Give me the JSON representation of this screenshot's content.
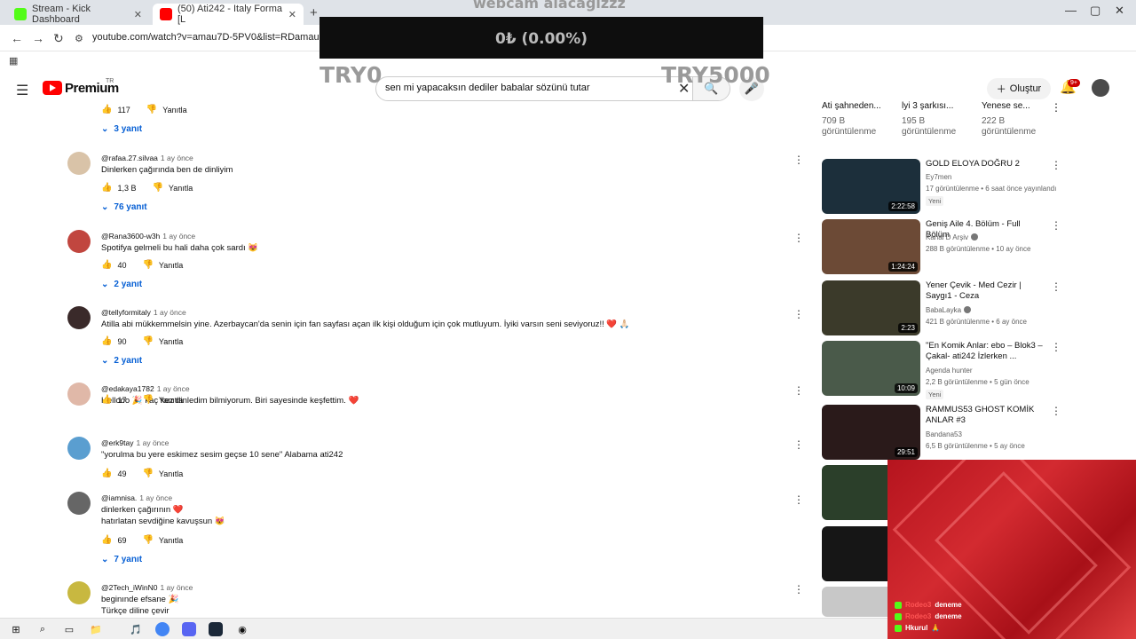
{
  "browser": {
    "tabs": [
      {
        "label": "Stream - Kick Dashboard",
        "active": false
      },
      {
        "label": "(50) Ati242 - Italy Forma [L",
        "active": true
      }
    ],
    "url": "youtube.com/watch?v=amau7D-5PV0&list=RDamau7D..."
  },
  "youtube": {
    "premium_label": "Premium",
    "country": "TR",
    "search_value": "sen mi yapacaksın dediler babalar sözünü tutar",
    "create_label": "Oluştur",
    "notif_count": "9+"
  },
  "overlay": {
    "title": "webcam alacağızzz",
    "value": "0₺ (0.00%)",
    "min": "TRY0",
    "max": "TRY5000"
  },
  "top_actions": {
    "likes": "117",
    "reply": "Yanıtla",
    "replies": "3 yanıt"
  },
  "comments": [
    {
      "user": "@rafaa.27.silvaa",
      "time": "1 ay önce",
      "text": "Dinlerken çağırında ben de dinliyim",
      "text2": "",
      "likes": "1,3 B",
      "reply": "Yanıtla",
      "replies": "76 yanıt"
    },
    {
      "user": "@Rana3600-w3h",
      "time": "1 ay önce",
      "text": "Spotifya gelmeli bu hali daha çok sardı 😻",
      "text2": "",
      "likes": "40",
      "reply": "Yanıtla",
      "replies": "2 yanıt"
    },
    {
      "user": "@tellyformitaly",
      "time": "1 ay önce",
      "text": "Atilla abi mükkemmelsin yine. Azerbaycan'da senin için fan sayfası açan ilk kişi olduğum için çok mutluyum. İyiki varsın seni seviyoruz!! ❤️ 🙏🏻",
      "text2": "",
      "likes": "90",
      "reply": "Yanıtla",
      "replies": "2 yanıt"
    },
    {
      "user": "@edakaya1782",
      "time": "1 ay önce",
      "text": "Hellooo 🎉 kaç kez dinledim bilmiyorum. Biri sayesinde keşfettim. ❤️",
      "text2": "",
      "likes": "17",
      "reply": "Yanıtla",
      "replies": ""
    },
    {
      "user": "@erk9tay",
      "time": "1 ay önce",
      "text": "\"yorulma bu yere eskimez sesim geçse 10 sene\" Alabama ati242",
      "text2": "",
      "likes": "49",
      "reply": "Yanıtla",
      "replies": ""
    },
    {
      "user": "@iamnisa.",
      "time": "1 ay önce",
      "text": "dinlerken çağırının ❤️",
      "text2": "hatırlatan sevdiğine kavuşsun 😻",
      "likes": "69",
      "reply": "Yanıtla",
      "replies": "7 yanıt"
    },
    {
      "user": "@2Tech_iWinN0",
      "time": "1 ay önce",
      "text": "beginınde efsane 🎉",
      "text2": "Türkçe diline çevir",
      "likes": "",
      "reply": "",
      "replies": ""
    }
  ],
  "shorts": [
    {
      "title": "Ati şahneden...",
      "views": "709 B",
      "views2": "görüntülenme"
    },
    {
      "title": "lyi 3 şarkısı...",
      "views": "195 B",
      "views2": "görüntülenme"
    },
    {
      "title": "Yenese se...",
      "views": "222 B",
      "views2": "görüntülenme"
    }
  ],
  "recommendations": [
    {
      "title": "GOLD ELOYA DOĞRU 2",
      "channel": "Ey7men",
      "meta": "17 görüntülenme • 6 saat önce yayınlandı",
      "badge": "Yeni",
      "duration": "2:22:58",
      "thumb": "#1c2f3b"
    },
    {
      "title": "Geniş Aile 4. Bölüm - Full Bölüm",
      "channel": "Kanal D Arşiv",
      "meta": "288 B görüntülenme • 10 ay önce",
      "badge": "",
      "duration": "1:24:24",
      "thumb": "#6c4a36"
    },
    {
      "title": "Yener Çevik - Med Cezir | Saygı1 - Ceza",
      "channel": "BabaLayka",
      "meta": "421 B görüntülenme • 6 ay önce",
      "badge": "",
      "duration": "2:23",
      "thumb": "#3b3a2a"
    },
    {
      "title": "\"En Komik Anlar: ebo  – Blok3 – Çakal- ati242  İzlerken ...",
      "channel": "Agenda hunter",
      "meta": "2,2 B görüntülenme • 5 gün önce",
      "badge": "Yeni",
      "duration": "10:09",
      "thumb": "#4a5a4a"
    },
    {
      "title": "RAMMUS53 GHOST KOMİK ANLAR #3",
      "channel": "Bandana53",
      "meta": "6,5 B görüntülenme • 5 ay önce",
      "badge": "",
      "duration": "29:51",
      "thumb": "#2a1a1a"
    },
    {
      "title": "",
      "channel": "",
      "meta": "",
      "badge": "",
      "duration": "",
      "thumb": "#2b3f2a"
    },
    {
      "title": "",
      "channel": "",
      "meta": "",
      "badge": "",
      "duration": "",
      "thumb": "#161616"
    },
    {
      "title": "",
      "channel": "",
      "meta": "",
      "badge": "",
      "duration": "",
      "thumb": "#c8c8c8"
    }
  ],
  "chat": [
    {
      "user": "Rodeo3",
      "text": "deneme"
    },
    {
      "user": "Rodeo3",
      "text": "deneme"
    },
    {
      "user": "Hkurul",
      "text": "🙏"
    }
  ],
  "colors": {
    "accent": "#ff0000",
    "link": "#065fd4",
    "chat_bg": "#c41e24",
    "kick_green": "#53fc18"
  }
}
